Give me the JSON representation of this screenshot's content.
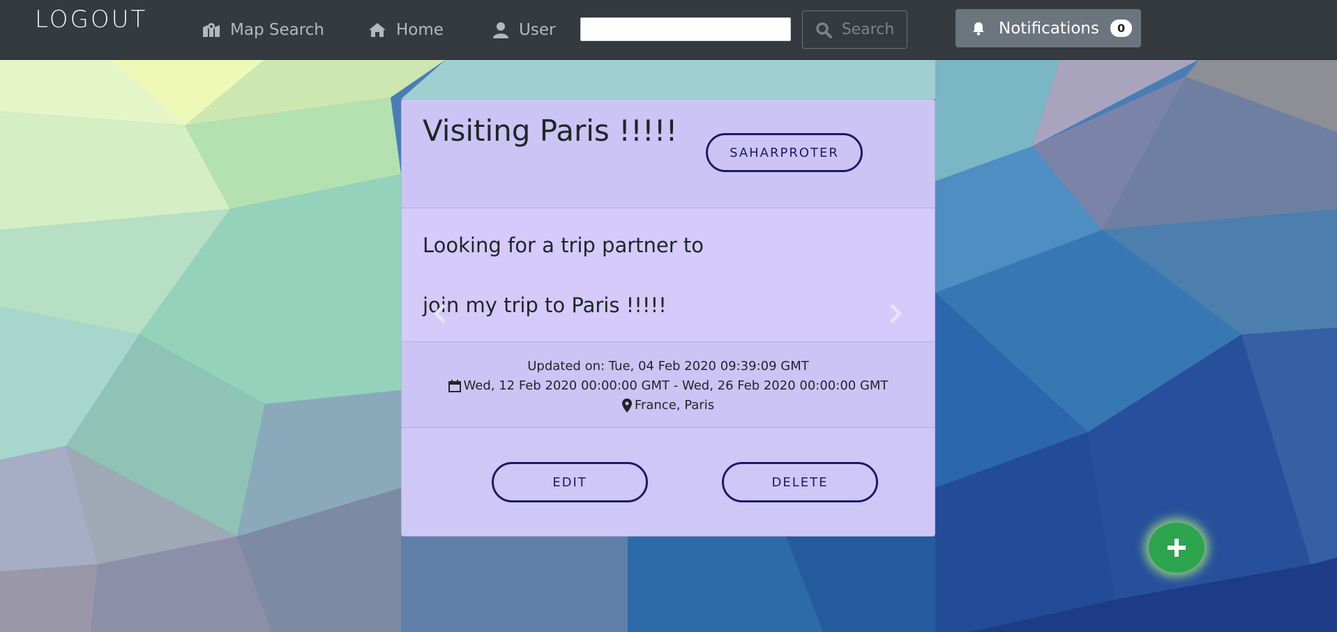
{
  "nav": {
    "brand": "LOGOUT",
    "map_search": "Map Search",
    "home": "Home",
    "user": "User",
    "search_value": "",
    "search_button": "Search",
    "notifications_label": "Notifications",
    "notifications_count": "0"
  },
  "post": {
    "title": "Visiting Paris !!!!!",
    "author_button": "SAHARPROTER",
    "body_line_1": "Looking for a trip partner to",
    "body_line_2": "join my trip to Paris !!!!!",
    "updated": "Updated on: Tue, 04 Feb 2020 09:39:09 GMT",
    "dates": "Wed, 12 Feb 2020 00:00:00 GMT -  Wed, 26 Feb 2020 00:00:00 GMT",
    "location": "France,  Paris",
    "edit_button": "EDIT",
    "delete_button": "DELETE"
  },
  "icons": {
    "map": "map-marked-icon",
    "home": "home-icon",
    "user": "user-icon",
    "search": "search-icon",
    "bell": "bell-icon",
    "calendar": "calendar-icon",
    "location": "map-marker-icon",
    "prev": "chevron-left-icon",
    "next": "chevron-right-icon",
    "add": "plus-icon"
  },
  "colors": {
    "navbar": "#343a40",
    "card": "#d1c9f7",
    "button_border": "#1c1a66",
    "fab": "#2da44e"
  }
}
